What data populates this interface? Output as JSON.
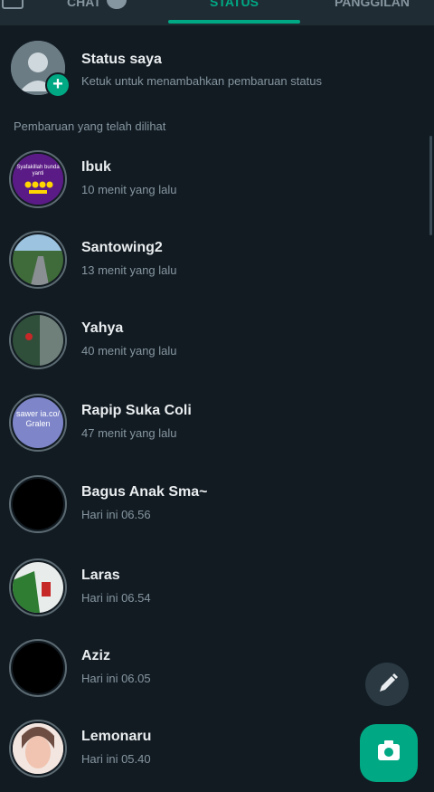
{
  "tabs": [
    {
      "label": "CHAT"
    },
    {
      "label": "STATUS"
    },
    {
      "label": "PANGGILAN"
    }
  ],
  "my_status": {
    "title": "Status saya",
    "subtitle": "Ketuk untuk menambahkan pembaruan status"
  },
  "section_title": "Pembaruan yang telah dilihat",
  "statuses": [
    {
      "name": "Ibuk",
      "time": "10 menit yang lalu",
      "thumb_text": "Syafakillah bunda yanti"
    },
    {
      "name": "Santowing2",
      "time": "13 menit yang lalu"
    },
    {
      "name": "Yahya",
      "time": "40 menit yang lalu"
    },
    {
      "name": "Rapip Suka Coli",
      "time": "47 menit yang lalu",
      "thumb_text": "sawer ia.co/ Gralen"
    },
    {
      "name": "Bagus Anak Sma~",
      "time": "Hari ini 06.56"
    },
    {
      "name": "Laras",
      "time": "Hari ini 06.54"
    },
    {
      "name": "Aziz",
      "time": "Hari ini 06.05"
    },
    {
      "name": "Lemonaru",
      "time": "Hari ini 05.40"
    }
  ],
  "icons": {
    "edit": "pencil-icon",
    "camera": "camera-icon"
  },
  "colors": {
    "accent": "#00a884",
    "background": "#121b22"
  }
}
